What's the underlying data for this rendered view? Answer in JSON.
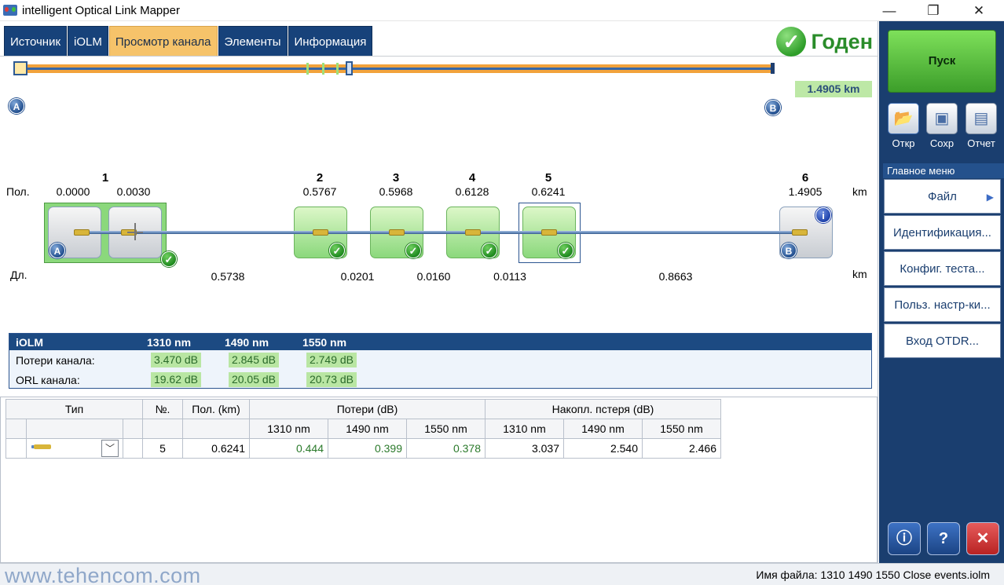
{
  "window": {
    "title": "intelligent Optical Link Mapper",
    "minimize": "—",
    "maximize": "❐",
    "close": "✕"
  },
  "tabs": [
    {
      "label": "Источник"
    },
    {
      "label": "iOLM"
    },
    {
      "label": "Просмотр канала"
    },
    {
      "label": "Элементы"
    },
    {
      "label": "Информация"
    }
  ],
  "status": {
    "verdict": "Годен",
    "icon": "check-circle-icon",
    "color": "#2a8c2a"
  },
  "overview": {
    "length": "1.4905 km",
    "marker_a": "A",
    "marker_b": "B"
  },
  "link": {
    "pos_label": "Пол.",
    "len_label": "Дл.",
    "unit": "km",
    "events": [
      {
        "num": "1",
        "pos_a": "0.0000",
        "pos_b": "0.0030"
      },
      {
        "num": "2",
        "pos": "0.5767"
      },
      {
        "num": "3",
        "pos": "0.5968"
      },
      {
        "num": "4",
        "pos": "0.6128"
      },
      {
        "num": "5",
        "pos": "0.6241"
      },
      {
        "num": "6",
        "pos": "1.4905"
      }
    ],
    "segments": [
      "0.5738",
      "0.0201",
      "0.0160",
      "0.0113",
      "0.8663"
    ]
  },
  "summary": {
    "title": "iOLM",
    "wavelengths": [
      "1310 nm",
      "1490 nm",
      "1550 nm"
    ],
    "loss_label": "Потери канала:",
    "loss": [
      "3.470 dB",
      "2.845 dB",
      "2.749 dB"
    ],
    "orl_label": "ORL канала:",
    "orl": [
      "19.62 dB",
      "20.05 dB",
      "20.73 dB"
    ]
  },
  "table": {
    "col_type": "Тип",
    "col_num": "№.",
    "col_pos": "Пол. (km)",
    "col_loss": "Потери (dB)",
    "col_cum": "Накопл. пстеря (dB)",
    "wl": [
      "1310 nm",
      "1490 nm",
      "1550 nm"
    ],
    "row": {
      "num": "5",
      "pos": "0.6241",
      "loss": [
        "0.444",
        "0.399",
        "0.378"
      ],
      "cum": [
        "3.037",
        "2.540",
        "2.466"
      ]
    }
  },
  "sidebar": {
    "start": "Пуск",
    "open": "Откр",
    "save": "Сохр",
    "report": "Отчет",
    "menu_title": "Главное меню",
    "menu": [
      "Файл",
      "Идентификация...",
      "Конфиг. теста...",
      "Польз. настр-ки...",
      "Вход OTDR..."
    ],
    "menu_arrow": "▶"
  },
  "statusbar": {
    "watermark": "www.tehencom.com",
    "filename": "Имя файла: 1310 1490 1550 Close events.iolm"
  }
}
